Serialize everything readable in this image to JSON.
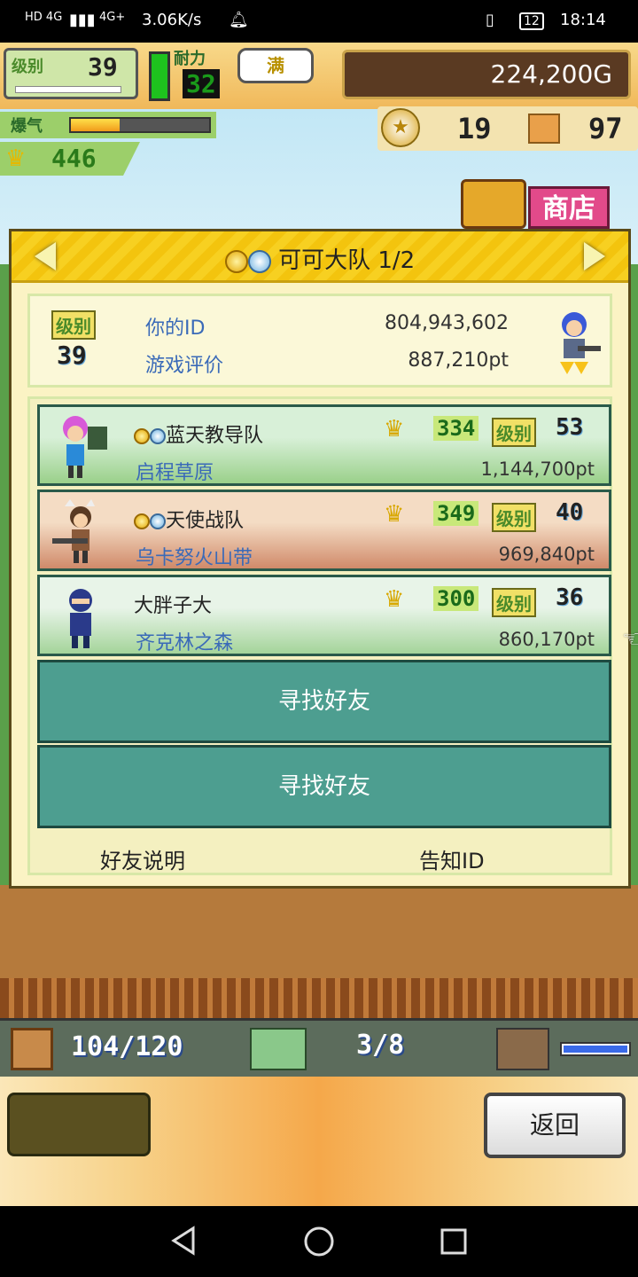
{
  "status_bar": {
    "network_left": "HD 4G",
    "network_right": "4G+",
    "speed": "3.06K/s",
    "battery": "12",
    "time": "18:14"
  },
  "hud": {
    "level_label": "级别",
    "level": "39",
    "stamina_label": "耐力",
    "stamina": "32",
    "bubble": "满",
    "gold": "224,200G",
    "hot_label": "爆气",
    "hot_fill": 0.35,
    "medals": "19",
    "boxes": "97",
    "crowns": "446",
    "shop_label": "商店"
  },
  "panel": {
    "title": "可可大队 1/2",
    "my_level_label": "级别",
    "my_level": "39",
    "my_id_label": "你的ID",
    "my_id": "804,943,602",
    "rating_label": "游戏评价",
    "rating": "887,210pt",
    "friends": [
      {
        "name": "蓝天教导队",
        "place": "启程草原",
        "points": "1,144,700pt",
        "crowns": "334",
        "level_label": "级别",
        "level": "53"
      },
      {
        "name": "天使战队",
        "place": "乌卡努火山带",
        "points": "969,840pt",
        "crowns": "349",
        "level_label": "级别",
        "level": "40"
      },
      {
        "name": "大胖子大",
        "place": "齐克林之森",
        "points": "860,170pt",
        "crowns": "300",
        "level_label": "级别",
        "level": "36"
      }
    ],
    "find_friend_1": "寻找好友",
    "find_friend_2": "寻找好友",
    "help_label": "好友说明",
    "tell_id_label": "告知ID"
  },
  "bottom": {
    "stock": "104/120",
    "vehicles": "3/8",
    "back_label": "返回"
  },
  "colors": {
    "panel_header": "#f7d021",
    "find_button": "#4d9e90",
    "place_text": "#3a6ab8"
  }
}
